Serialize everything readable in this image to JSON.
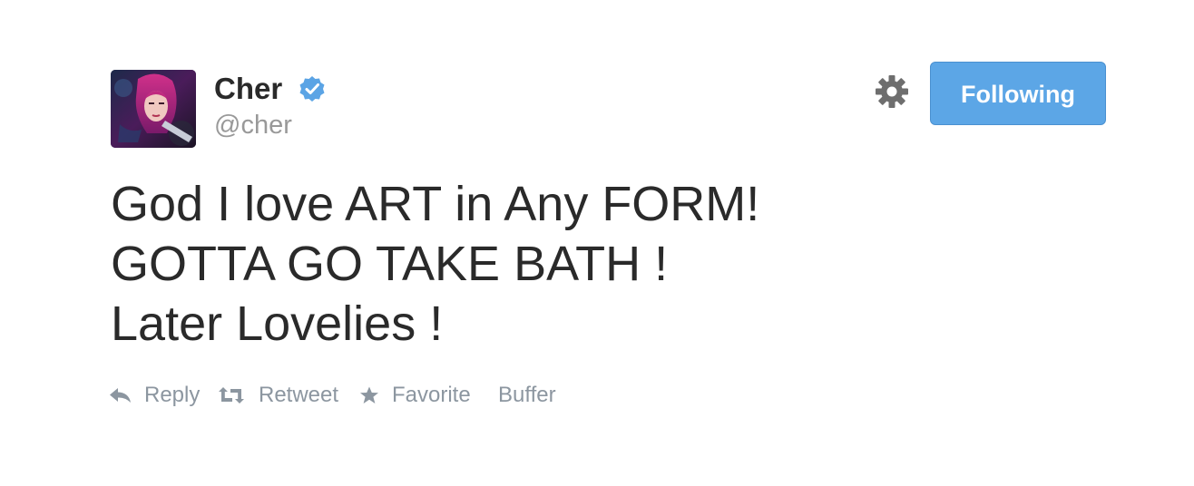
{
  "user": {
    "name": "Cher",
    "handle": "@cher",
    "verified": true
  },
  "follow_button": {
    "label": "Following"
  },
  "tweet": {
    "lines": [
      "God I love ART in Any FORM!",
      "GOTTA GO TAKE BATH !",
      "Later Lovelies !"
    ]
  },
  "actions": {
    "reply": "Reply",
    "retweet": "Retweet",
    "favorite": "Favorite",
    "buffer": "Buffer"
  },
  "colors": {
    "accent": "#5ca6e6",
    "verified": "#5ba4e5",
    "text": "#2a2a2a",
    "muted": "#8c96a0"
  },
  "icons": [
    "verified-badge-icon",
    "gear-icon",
    "reply-icon",
    "retweet-icon",
    "favorite-star-icon"
  ]
}
